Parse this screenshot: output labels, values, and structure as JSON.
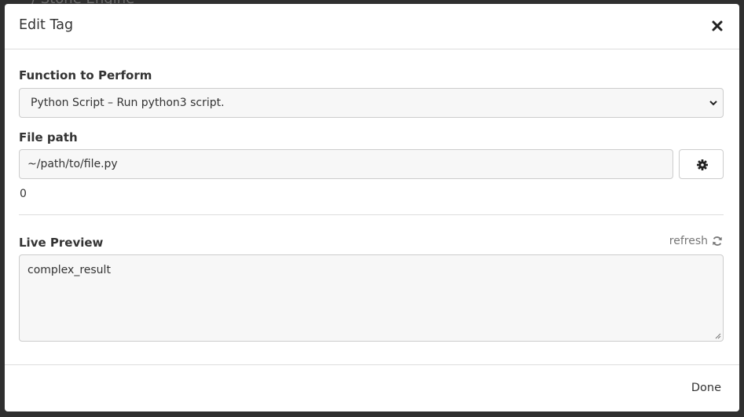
{
  "backdrop": {
    "text": "/ Stone Engine"
  },
  "modal": {
    "title": "Edit Tag",
    "close_icon": "close-icon"
  },
  "function": {
    "label": "Function to Perform",
    "selected": "Python Script – Run python3 script."
  },
  "file_path": {
    "label": "File path",
    "value": "~/path/to/file.py",
    "settings_icon": "gear-icon",
    "help_value": "0"
  },
  "live_preview": {
    "label": "Live Preview",
    "refresh_label": "refresh",
    "refresh_icon": "refresh-icon",
    "value": "complex_result"
  },
  "footer": {
    "done_label": "Done"
  },
  "colors": {
    "border": "#cccccc",
    "input_bg": "#f7f7f7",
    "text": "#333333",
    "muted": "#777777"
  }
}
